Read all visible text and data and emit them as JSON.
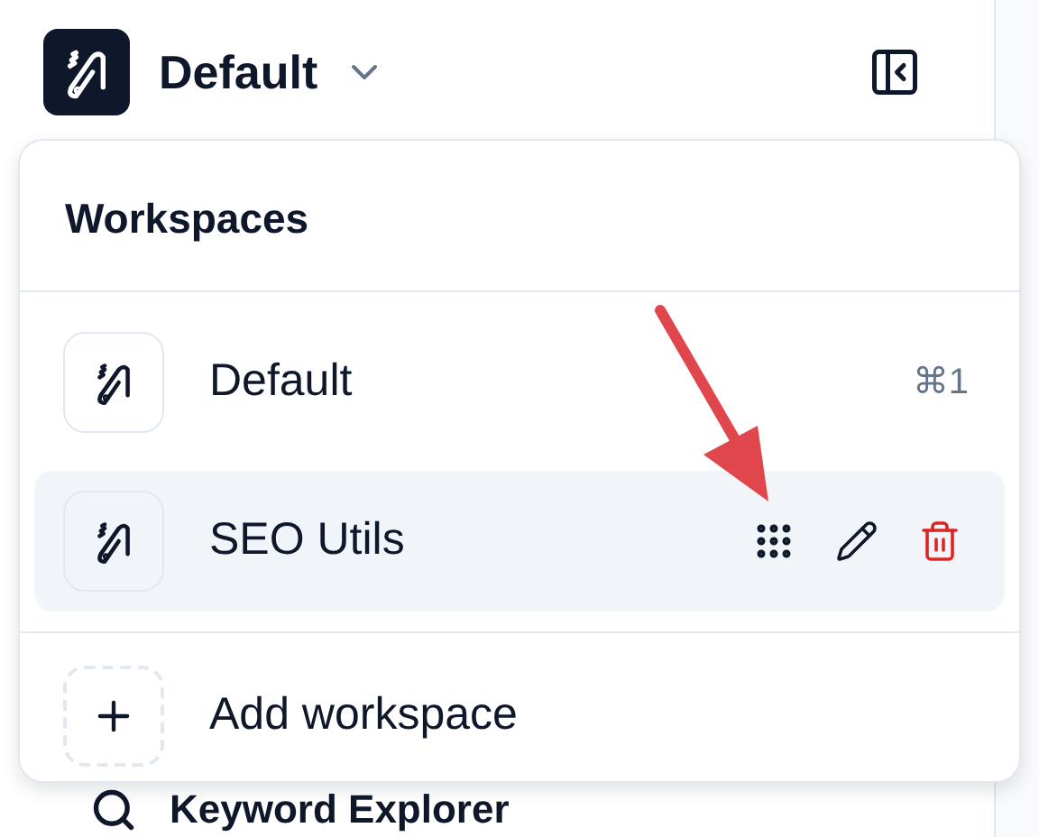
{
  "header": {
    "workspace_name": "Default"
  },
  "menu": {
    "title": "Workspaces",
    "items": [
      {
        "name": "Default",
        "shortcut": "⌘1",
        "highlighted": false
      },
      {
        "name": "SEO Utils",
        "highlighted": true
      }
    ],
    "add_label": "Add workspace"
  },
  "nav": [
    {
      "label": "Keyword Explorer"
    }
  ]
}
